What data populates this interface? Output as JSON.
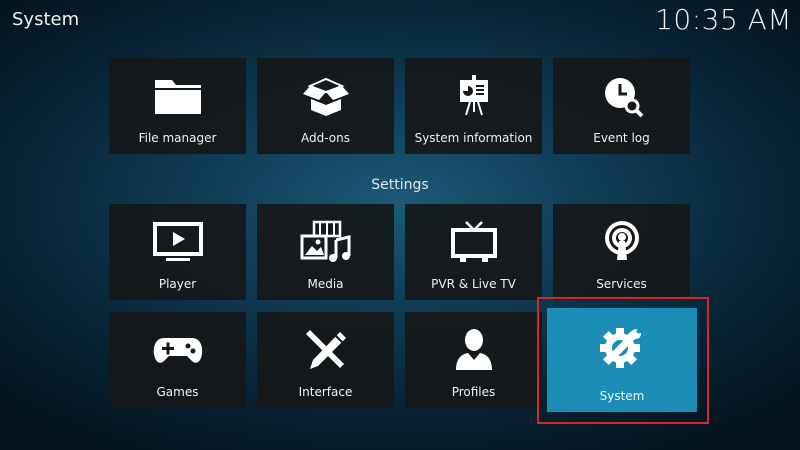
{
  "header": {
    "title": "System",
    "clock": "10:35 AM"
  },
  "top_tiles": [
    {
      "label": "File manager",
      "icon": "folder-icon"
    },
    {
      "label": "Add-ons",
      "icon": "open-box-icon"
    },
    {
      "label": "System information",
      "icon": "presentation-chart-icon"
    },
    {
      "label": "Event log",
      "icon": "clock-search-icon"
    }
  ],
  "settings": {
    "heading": "Settings",
    "tiles": [
      {
        "label": "Player",
        "icon": "tv-play-icon"
      },
      {
        "label": "Media",
        "icon": "media-icon"
      },
      {
        "label": "PVR & Live TV",
        "icon": "tv-antenna-icon"
      },
      {
        "label": "Services",
        "icon": "broadcast-icon"
      },
      {
        "label": "Games",
        "icon": "gamepad-icon"
      },
      {
        "label": "Interface",
        "icon": "pencil-ruler-icon"
      },
      {
        "label": "Profiles",
        "icon": "user-profile-icon"
      },
      {
        "label": "System",
        "icon": "gear-wrench-icon",
        "selected": true
      }
    ]
  },
  "colors": {
    "tile_bg": "#16181a",
    "selected_bg": "#1b8db6",
    "focus_outline": "#d9262b"
  }
}
